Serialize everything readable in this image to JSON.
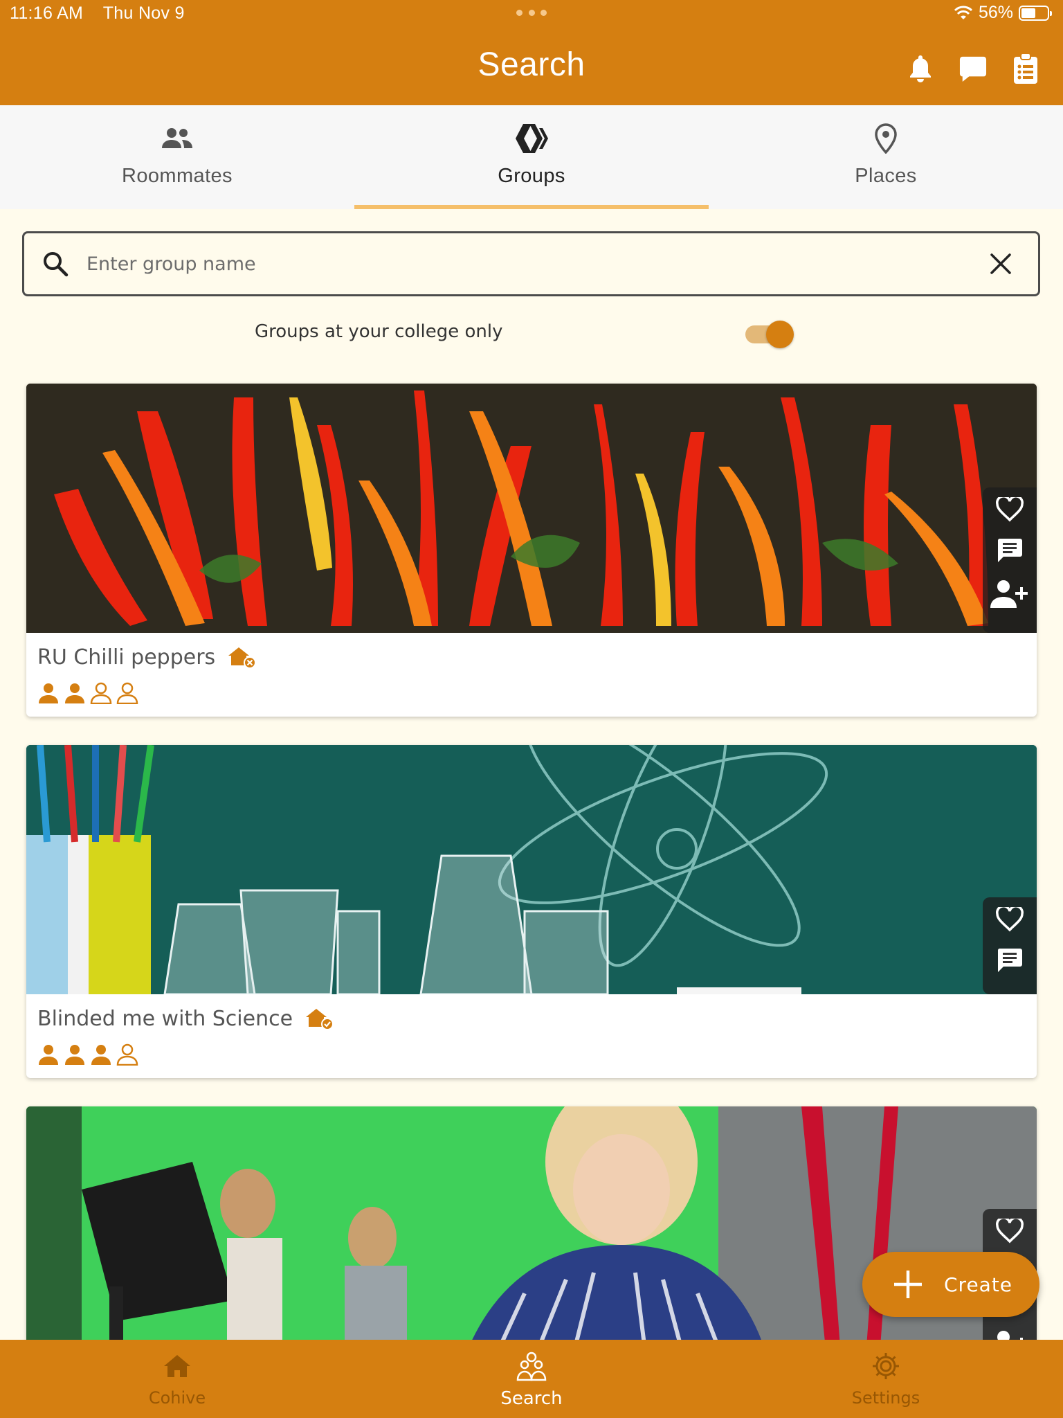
{
  "status_bar": {
    "time": "11:16 AM",
    "date": "Thu Nov 9",
    "battery": "56%",
    "battery_level": 0.56
  },
  "header": {
    "title": "Search",
    "actions": [
      "bell-icon",
      "chat-icon",
      "clipboard-icon"
    ]
  },
  "tabs": [
    {
      "label": "Roommates",
      "icon": "people-icon",
      "active": false
    },
    {
      "label": "Groups",
      "icon": "hive-icon",
      "active": true
    },
    {
      "label": "Places",
      "icon": "location-pin-icon",
      "active": false
    }
  ],
  "search": {
    "placeholder": "Enter group name",
    "value": ""
  },
  "filter": {
    "label": "Groups at your college only",
    "enabled": true
  },
  "groups": [
    {
      "name": "RU Chilli peppers",
      "status_icon": "house-x-icon",
      "members_filled": 2,
      "members_total": 4,
      "actions": [
        "heart-icon",
        "message-icon",
        "add-person-icon"
      ]
    },
    {
      "name": "Blinded me with Science",
      "status_icon": "house-check-icon",
      "members_filled": 3,
      "members_total": 4,
      "actions": [
        "heart-icon",
        "message-icon"
      ]
    },
    {
      "name": "",
      "actions": [
        "heart-icon",
        "add-person-icon"
      ]
    }
  ],
  "fab": {
    "label": "Create",
    "icon": "plus-icon"
  },
  "bottom_nav": [
    {
      "label": "Cohive",
      "icon": "home-icon",
      "active": false
    },
    {
      "label": "Search",
      "icon": "search-people-icon",
      "active": true
    },
    {
      "label": "Settings",
      "icon": "gear-icon",
      "active": false
    }
  ],
  "colors": {
    "brand": "#d57f11",
    "tab_indicator": "#f5bf6a",
    "background": "#fffbec"
  }
}
